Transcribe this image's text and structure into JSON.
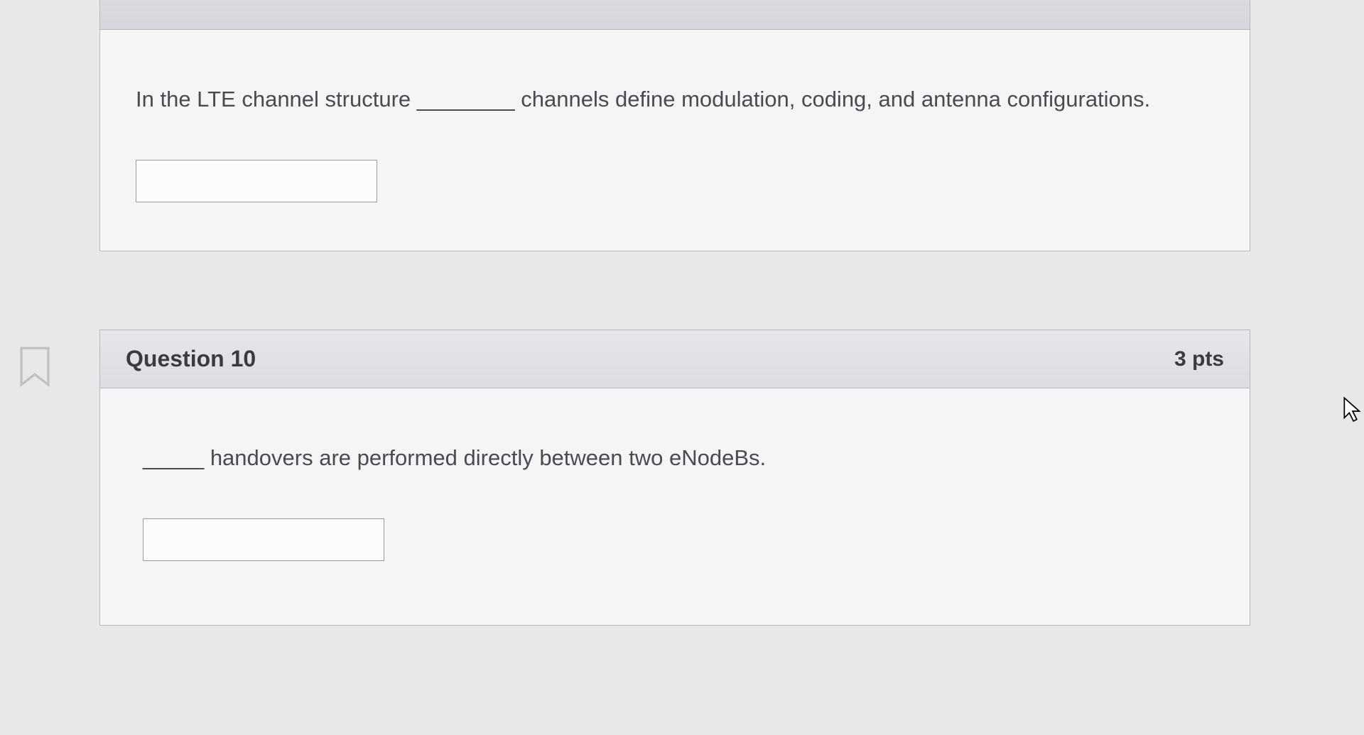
{
  "questions": {
    "q9": {
      "text": "In the LTE channel structure ________ channels define modulation, coding, and antenna configurations.",
      "answer_value": ""
    },
    "q10": {
      "title": "Question 10",
      "points": "3 pts",
      "text": "_____ handovers are performed directly between two eNodeBs.",
      "answer_value": ""
    }
  }
}
